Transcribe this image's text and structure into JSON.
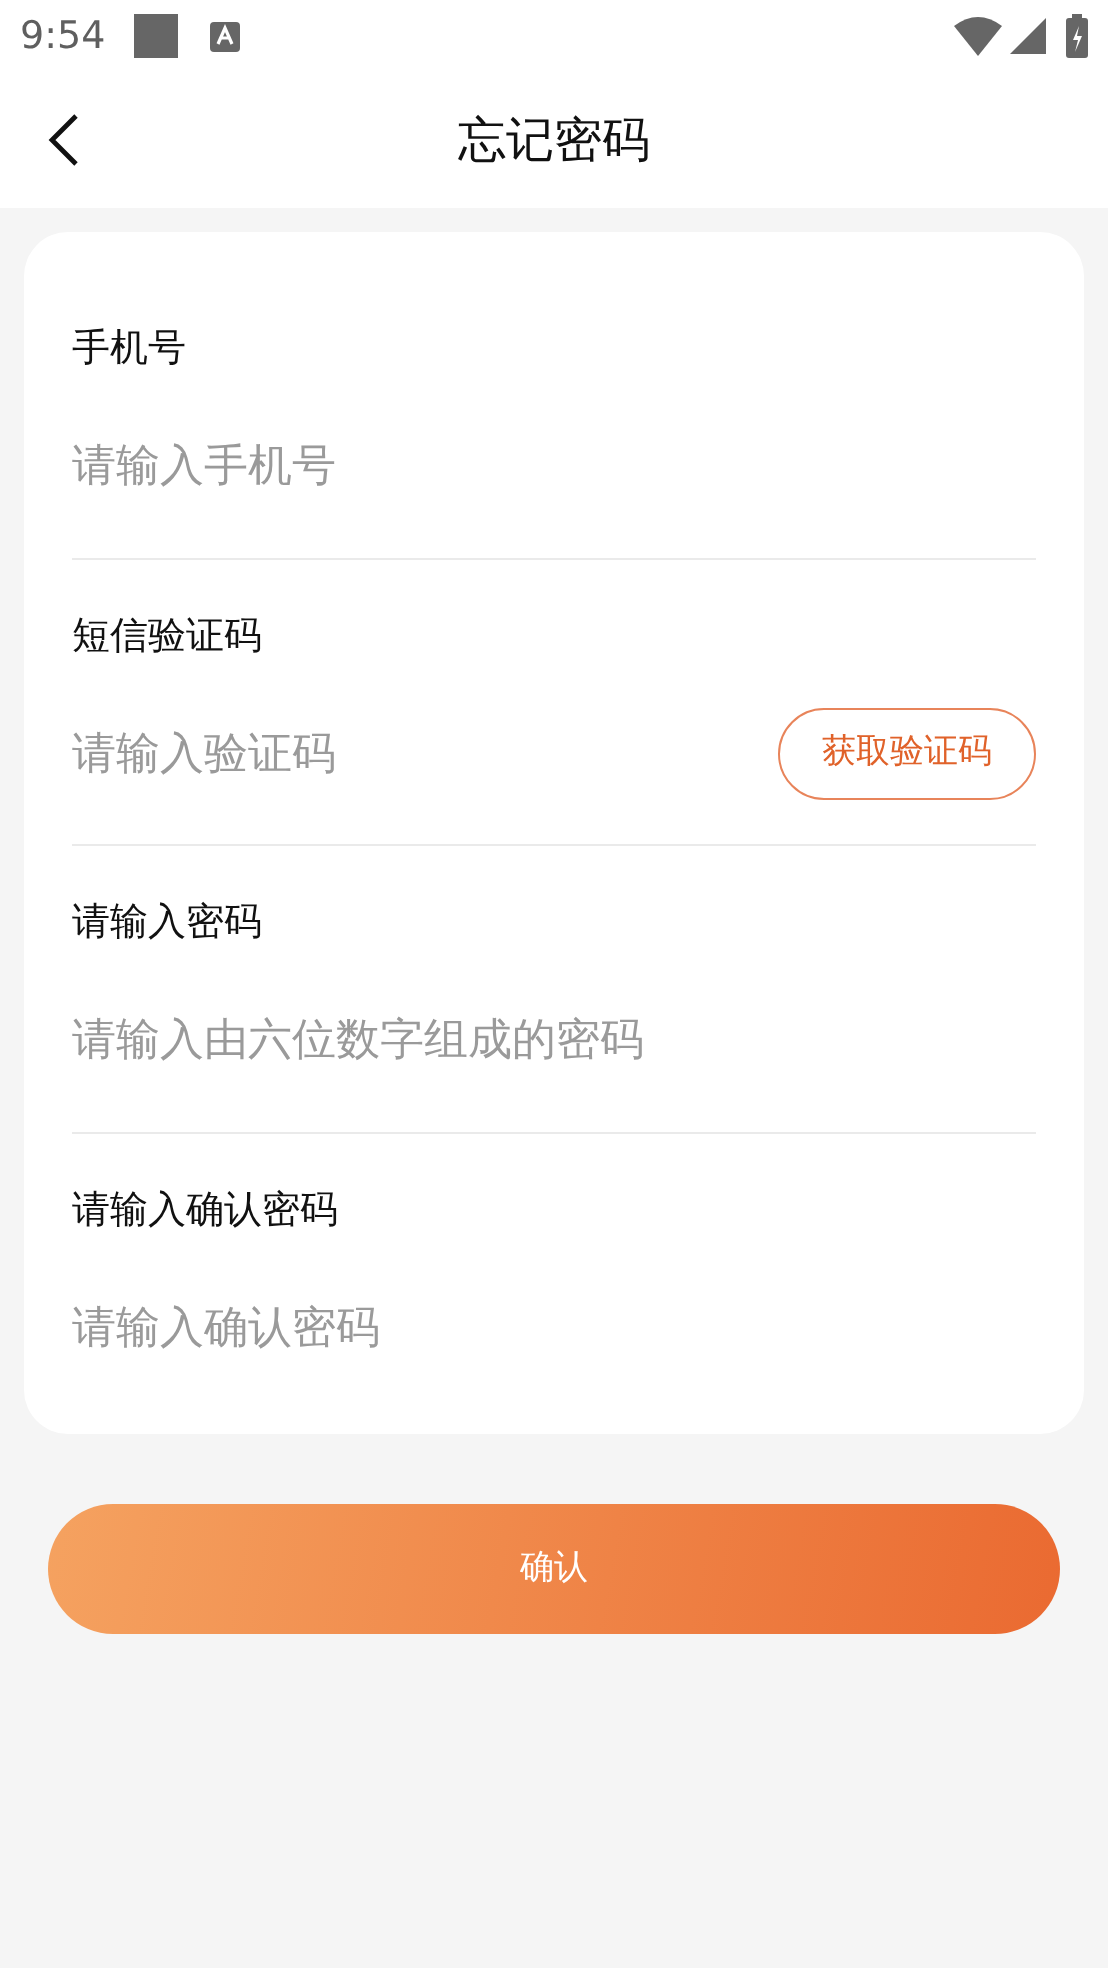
{
  "status_bar": {
    "time": "9:54"
  },
  "header": {
    "title": "忘记密码"
  },
  "fields": [
    {
      "kind": "plain",
      "label": "手机号",
      "placeholder": "请输入手机号"
    },
    {
      "kind": "code",
      "label": "短信验证码",
      "placeholder": "请输入验证码",
      "action": "获取验证码"
    },
    {
      "kind": "plain",
      "label": "请输入密码",
      "placeholder": "请输入由六位数字组成的密码"
    },
    {
      "kind": "plain",
      "label": "请输入确认密码",
      "placeholder": "请输入确认密码"
    }
  ],
  "confirm_button": "确认"
}
